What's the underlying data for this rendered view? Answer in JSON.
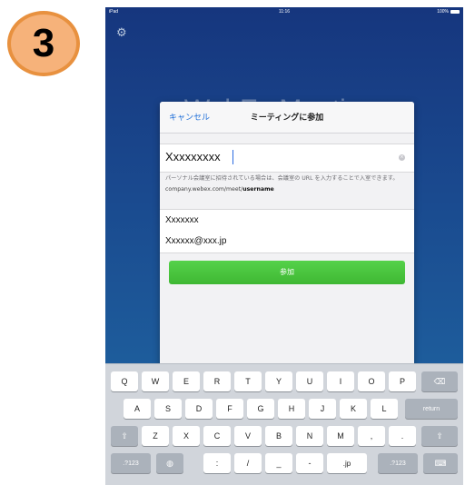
{
  "step": "3",
  "status_bar": {
    "device": "iPad",
    "time": "11:16",
    "battery": "100%"
  },
  "background": {
    "title": "WebEx Meetings"
  },
  "sheet": {
    "cancel_label": "キャンセル",
    "title": "ミーティングに参加",
    "meeting_field_value": "Xxxxxxxxx",
    "hint_text": "パーソナル会議室に招待されている場合は、会議室の URL を入力することで入室できます。",
    "hint_url_prefix": "company.webex.com/meet/",
    "hint_url_suffix": "username",
    "name_value": "Xxxxxxx",
    "email_value": "Xxxxxx@xxx.jp",
    "join_label": "参加"
  },
  "keyboard": {
    "row1": [
      "Q",
      "W",
      "E",
      "R",
      "T",
      "Y",
      "U",
      "I",
      "O",
      "P"
    ],
    "row2": [
      "A",
      "S",
      "D",
      "F",
      "G",
      "H",
      "J",
      "K",
      "L"
    ],
    "row3": [
      "Z",
      "X",
      "C",
      "V",
      "B",
      "N",
      "M",
      ",",
      "."
    ],
    "return_label": "return",
    "num_left_label": ".?123",
    "num_right_label": ".?123",
    "colon_label": ":",
    "slash_label": "/",
    "underscore_label": "_",
    "dash_label": "-",
    "jp_label": ".jp"
  },
  "colors": {
    "accent": "#1f6fd8",
    "join_green": "#45c03a",
    "badge": "#f6b27a"
  }
}
